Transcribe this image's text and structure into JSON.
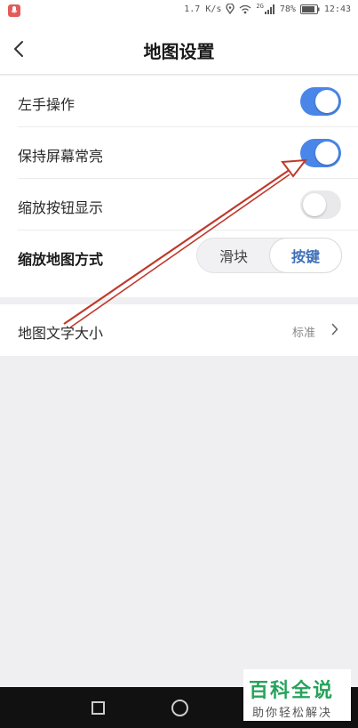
{
  "status_bar": {
    "speed": "1.7 K/s",
    "network": "2G",
    "battery": "78%",
    "time": "12:43",
    "icons": [
      "mic-icon",
      "location-icon",
      "wifi-icon",
      "signal-icon",
      "battery-icon"
    ]
  },
  "header": {
    "title": "地图设置",
    "back_icon": "chevron-left-icon"
  },
  "settings": {
    "left_hand": {
      "label": "左手操作",
      "enabled": true
    },
    "keep_screen_on": {
      "label": "保持屏幕常亮",
      "enabled": true
    },
    "zoom_button": {
      "label": "缩放按钮显示",
      "enabled": false
    },
    "zoom_mode": {
      "label": "缩放地图方式",
      "options": [
        "滑块",
        "按键"
      ],
      "selected": "按键"
    },
    "text_size": {
      "label": "地图文字大小",
      "value": "标准",
      "chevron_icon": "chevron-right-icon"
    }
  },
  "colors": {
    "accent": "#4a86e8",
    "annotation_arrow": "#c0392b"
  },
  "watermark": {
    "main": "百科全说",
    "sub": "助你轻松解决"
  }
}
